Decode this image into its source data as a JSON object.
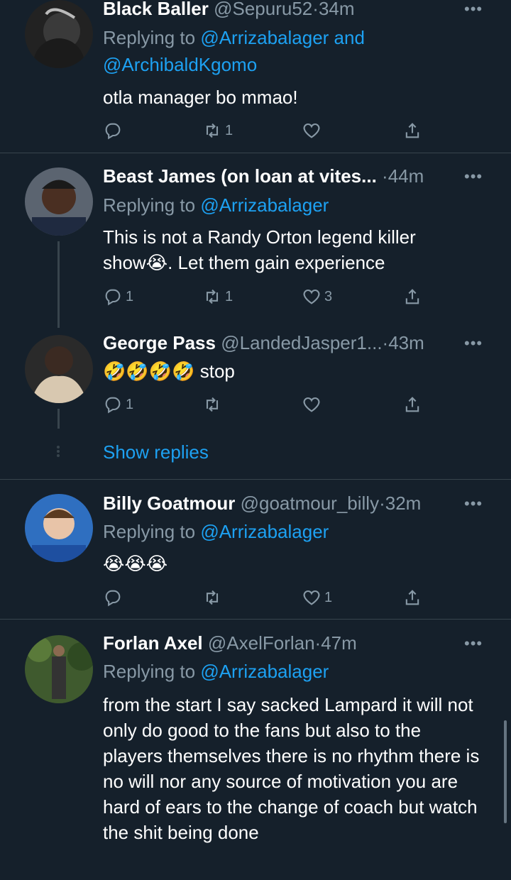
{
  "tweets": [
    {
      "name": "Black Baller",
      "handle": "@Sepuru52",
      "time": "34m",
      "replying_prefix": "Replying to ",
      "replying_to": "@Arrizabalager and @ArchibaldKgomo",
      "text": "otla manager bo mmao!",
      "counts": {
        "reply": "",
        "retweet": "1",
        "like": ""
      }
    },
    {
      "name": "Beast James (on loan at vites...",
      "handle": "",
      "time": "44m",
      "replying_prefix": "Replying to ",
      "replying_to": "@Arrizabalager",
      "text": "This is not a Randy Orton legend killer show😭. Let them gain experience",
      "counts": {
        "reply": "1",
        "retweet": "1",
        "like": "3"
      }
    },
    {
      "name": "George Pass",
      "handle": "@LandedJasper1...",
      "time": "43m",
      "replying_prefix": "",
      "replying_to": "",
      "text": "🤣🤣🤣🤣 stop",
      "counts": {
        "reply": "1",
        "retweet": "",
        "like": ""
      }
    },
    {
      "name": "Billy Goatmour",
      "handle": "@goatmour_billy",
      "time": "32m",
      "replying_prefix": "Replying to ",
      "replying_to": "@Arrizabalager",
      "text": "😭😭😭",
      "counts": {
        "reply": "",
        "retweet": "",
        "like": "1"
      }
    },
    {
      "name": "Forlan Axel",
      "handle": "@AxelForlan",
      "time": "47m",
      "replying_prefix": "Replying to ",
      "replying_to": "@Arrizabalager",
      "text": "from the start I say sacked Lampard it will not only do good to the fans but also to the players themselves there is no rhythm there is no will nor any source of motivation you are hard of ears to the change of coach but watch the shit being done",
      "counts": {
        "reply": "",
        "retweet": "",
        "like": ""
      }
    }
  ],
  "show_replies": "Show replies",
  "separator": "·",
  "more": "•••",
  "colors": {
    "background": "#15202b",
    "secondary": "#8899a6",
    "link": "#1da1f2",
    "divider": "#38444d"
  },
  "icons": [
    "reply-icon",
    "retweet-icon",
    "like-icon",
    "share-icon",
    "more-icon"
  ]
}
